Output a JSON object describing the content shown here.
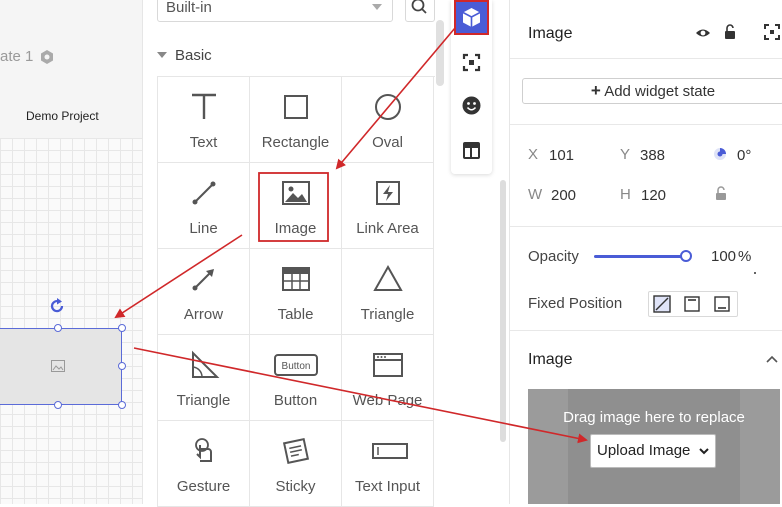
{
  "canvas": {
    "state_label": "ate 1",
    "project_name": "Demo Project"
  },
  "library": {
    "source_select": "Built-in",
    "section": "Basic",
    "widgets": [
      {
        "label": "Text",
        "icon": "text-icon"
      },
      {
        "label": "Rectangle",
        "icon": "rectangle-icon"
      },
      {
        "label": "Oval",
        "icon": "oval-icon"
      },
      {
        "label": "Line",
        "icon": "line-icon"
      },
      {
        "label": "Image",
        "icon": "image-icon"
      },
      {
        "label": "Link Area",
        "icon": "link-area-icon"
      },
      {
        "label": "Arrow",
        "icon": "arrow-icon"
      },
      {
        "label": "Table",
        "icon": "table-icon"
      },
      {
        "label": "Triangle",
        "icon": "triangle-icon"
      },
      {
        "label": "Triangle",
        "icon": "right-triangle-icon"
      },
      {
        "label": "Button",
        "icon": "button-icon"
      },
      {
        "label": "Web Page",
        "icon": "web-page-icon"
      },
      {
        "label": "Gesture",
        "icon": "gesture-icon"
      },
      {
        "label": "Sticky",
        "icon": "sticky-icon"
      },
      {
        "label": "Text Input",
        "icon": "text-input-icon"
      }
    ],
    "button_icon_text": "Button"
  },
  "vertical_toolbar": {
    "items": [
      "widgets-cube-icon",
      "components-icon",
      "emoji-icon",
      "templates-icon"
    ],
    "active_color": "#4a5cd6"
  },
  "inspector": {
    "title": "Image",
    "add_state": "Add widget state",
    "x_label": "X",
    "x_value": "101",
    "y_label": "Y",
    "y_value": "388",
    "rotation_value": "0°",
    "w_label": "W",
    "w_value": "200",
    "h_label": "H",
    "h_value": "120",
    "opacity_label": "Opacity",
    "opacity_value": "100",
    "opacity_unit": "%",
    "opacity_fraction": 1.0,
    "fixed_position_label": "Fixed Position",
    "image_section_title": "Image",
    "drop_text": "Drag image here to replace",
    "upload_button": "Upload Image"
  },
  "colors": {
    "accent": "#4a5cd6",
    "annotation": "#d0282a"
  }
}
